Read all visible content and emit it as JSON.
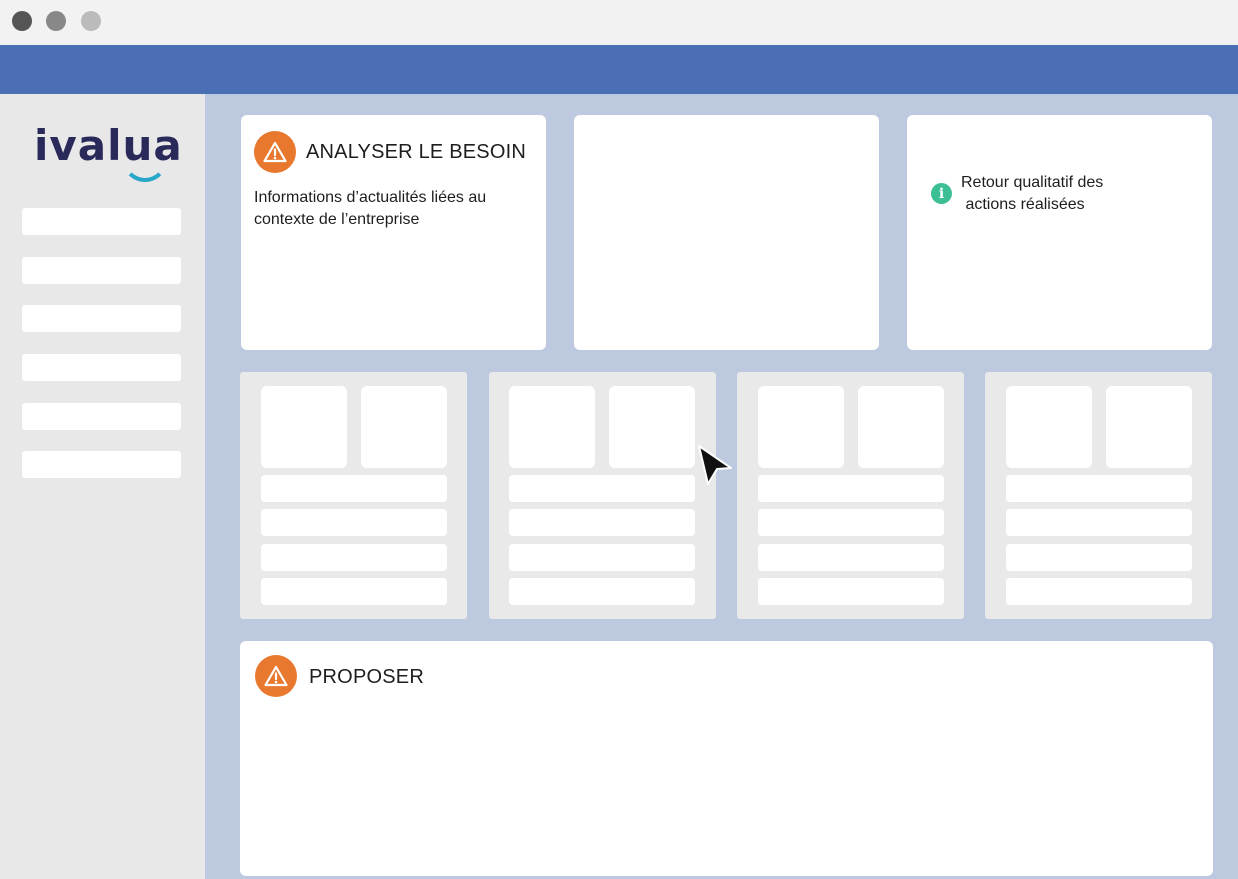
{
  "logo": {
    "text": "ivalua",
    "accent_color": "#29a7c8"
  },
  "colors": {
    "topbar": "#4a6fb5",
    "main_bg": "#bdc9df",
    "warning": "#e8782e",
    "info": "#3dbf95"
  },
  "cards": {
    "analyser": {
      "icon": "warning-icon",
      "title": "ANALYSER LE BESOIN",
      "line1": "Informations d’actualités liées au",
      "line2": "contexte de l’entreprise"
    },
    "feedback": {
      "icon": "info-icon",
      "icon_glyph": "i",
      "line1": "Retour qualitatif des",
      "line2": " actions réalisées"
    },
    "proposer": {
      "icon": "warning-icon",
      "title": "PROPOSER"
    }
  }
}
